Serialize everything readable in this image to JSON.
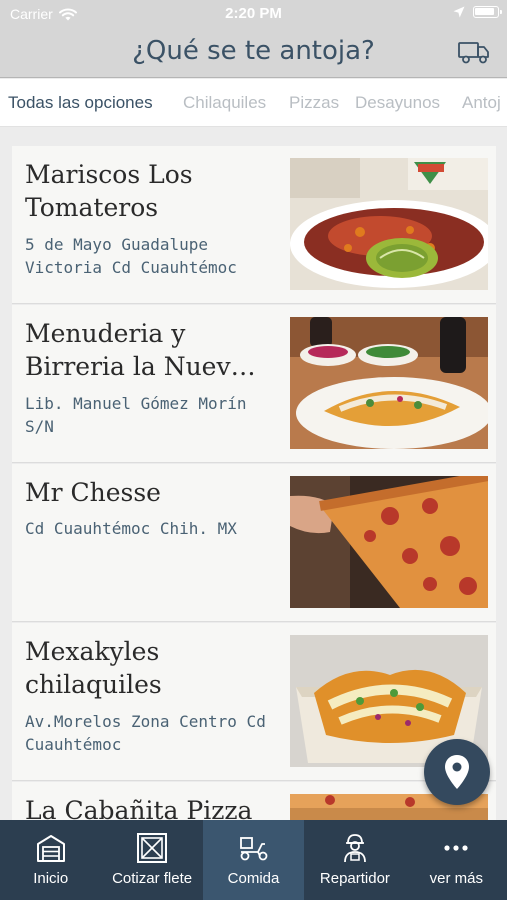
{
  "status_bar": {
    "carrier": "Carrier",
    "time": "2:20 PM",
    "icons": [
      "wifi-icon",
      "location-arrow-icon",
      "battery-icon"
    ]
  },
  "header": {
    "title": "¿Qué se te antoja?",
    "action_icon": "truck-icon"
  },
  "categories": {
    "items": [
      "Todas las opciones",
      "Chilaquiles",
      "Pizzas",
      "Desayunos",
      "Antoj"
    ],
    "selected": "Todas las opciones"
  },
  "restaurants": [
    {
      "name": "Mariscos Los Tomateros",
      "address": "5 de Mayo Guadalupe Victoria Cd Cuauhtémoc",
      "image": "seafood-tostada-photo"
    },
    {
      "name": "Menuderia y Birreria la Nuev…",
      "address": "Lib. Manuel Gómez Morín S/N",
      "image": "birria-taco-photo"
    },
    {
      "name": "Mr Chesse",
      "address": "Cd Cuauhtémoc Chih. MX",
      "image": "pizza-slice-photo"
    },
    {
      "name": "Mexakyles chilaquiles",
      "address": "Av.Morelos Zona Centro Cd Cuauhtémoc",
      "image": "chilaquiles-photo"
    },
    {
      "name": "La Cabañita Pizza",
      "address": "",
      "image": "pizza-photo"
    }
  ],
  "fab": {
    "icon": "map-pin-icon"
  },
  "tab_bar": {
    "items": [
      {
        "label": "Inicio",
        "icon": "warehouse-icon"
      },
      {
        "label": "Cotizar flete",
        "icon": "crate-icon"
      },
      {
        "label": "Comida",
        "icon": "delivery-scooter-icon"
      },
      {
        "label": "Repartidor",
        "icon": "courier-icon"
      },
      {
        "label": "ver más",
        "icon": "more-dots-icon"
      }
    ],
    "active": "Comida"
  },
  "colors": {
    "header_bg": "#d6d6d6",
    "title_text": "#3b5266",
    "tab_bar_bg": "#2c3e50",
    "tab_active_bg": "#3b566f",
    "address_text": "#4a6274"
  }
}
